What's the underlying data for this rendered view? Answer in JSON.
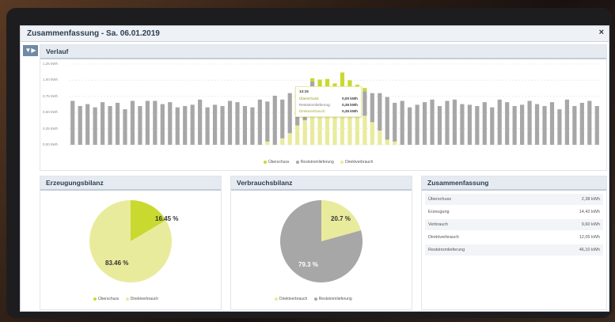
{
  "window": {
    "title": "Zusammenfassung - Sa. 06.01.2019",
    "close_label": "×",
    "filter_label": "▼▶"
  },
  "verlauf": {
    "title": "Verlauf"
  },
  "tooltip": {
    "time": "13:15",
    "rows": [
      {
        "label": "Überschuss:",
        "value": "0,00 kWh"
      },
      {
        "label": "Reststromlieferung:",
        "value": "0,35 kWh"
      },
      {
        "label": "Direktverbrauch:",
        "value": "0,35 kWh"
      }
    ]
  },
  "erzeugung": {
    "title": "Erzeugungsbilanz",
    "labels": [
      "16.45 %",
      "83.46 %"
    ],
    "legend": [
      "Überschuss",
      "Direktverbrauch"
    ]
  },
  "verbrauch": {
    "title": "Verbrauchsbilanz",
    "labels": [
      "20.7 %",
      "79.3 %"
    ],
    "legend": [
      "Direktverbrauch",
      "Reststromlieferung"
    ]
  },
  "summary": {
    "title": "Zusammenfassung",
    "rows": [
      {
        "label": "Überschuss",
        "value": "2,38 kWh"
      },
      {
        "label": "Erzeugung",
        "value": "14,42 kWh"
      },
      {
        "label": "Verbrauch",
        "value": "9,60 kWh"
      },
      {
        "label": "Direktverbrauch",
        "value": "12,05 kWh"
      },
      {
        "label": "Reststromlieferung",
        "value": "46,10 kWh"
      }
    ]
  },
  "colors": {
    "ueberschuss": "#c9d92f",
    "direkt": "#e9eb9c",
    "rest": "#a7a7a7"
  },
  "chart_data": [
    {
      "type": "bar",
      "ylabel": "",
      "ylim": [
        0,
        1.25
      ],
      "yticks": [
        "1,25 kWh",
        "1,00 kWh",
        "0,75 kWh",
        "0,50 kWh",
        "0,25 kWh",
        "0,00 kWh"
      ],
      "legend": [
        "Überschuss",
        "Reststromlieferung",
        "Direktverbrauch"
      ],
      "series": [
        {
          "name": "Reststromlieferung",
          "values": [
            0.68,
            0.6,
            0.63,
            0.58,
            0.66,
            0.6,
            0.65,
            0.55,
            0.68,
            0.6,
            0.68,
            0.68,
            0.63,
            0.66,
            0.58,
            0.6,
            0.62,
            0.7,
            0.58,
            0.62,
            0.6,
            0.68,
            0.66,
            0.6,
            0.58,
            0.7,
            0.62,
            0.76,
            0.6,
            0.62,
            0.6,
            0.5,
            0.4,
            0.28,
            0.17,
            0.1,
            0.1,
            0.22,
            0.28,
            0.38,
            0.45,
            0.58,
            0.66,
            0.6,
            0.68,
            0.58,
            0.62,
            0.66,
            0.7,
            0.6,
            0.68,
            0.7,
            0.63,
            0.62,
            0.6,
            0.66,
            0.58,
            0.7,
            0.66,
            0.6,
            0.62,
            0.68,
            0.63,
            0.6,
            0.66,
            0.55,
            0.7,
            0.6,
            0.65,
            0.68,
            0.6
          ]
        },
        {
          "name": "Überschuss",
          "values": [
            0,
            0,
            0,
            0,
            0,
            0,
            0,
            0,
            0,
            0,
            0,
            0,
            0,
            0,
            0,
            0,
            0,
            0,
            0,
            0,
            0,
            0,
            0,
            0,
            0,
            0,
            0,
            0,
            0,
            0,
            0,
            0,
            0.05,
            0.18,
            0.3,
            0.25,
            0.4,
            0.2,
            0.1,
            0.05,
            0,
            0,
            0,
            0,
            0,
            0,
            0,
            0,
            0,
            0,
            0,
            0,
            0,
            0,
            0,
            0,
            0,
            0,
            0,
            0,
            0,
            0,
            0,
            0,
            0,
            0,
            0,
            0,
            0,
            0,
            0
          ]
        },
        {
          "name": "Direktverbrauch",
          "values": [
            0,
            0,
            0,
            0,
            0,
            0,
            0,
            0,
            0,
            0,
            0,
            0,
            0,
            0,
            0,
            0,
            0,
            0,
            0,
            0,
            0,
            0,
            0,
            0,
            0,
            0,
            0.05,
            0,
            0.1,
            0.18,
            0.3,
            0.38,
            0.58,
            0.55,
            0.55,
            0.6,
            0.62,
            0.58,
            0.55,
            0.45,
            0.35,
            0.22,
            0.08,
            0.05,
            0,
            0,
            0,
            0,
            0,
            0,
            0,
            0,
            0,
            0,
            0,
            0,
            0,
            0,
            0,
            0,
            0,
            0,
            0,
            0,
            0,
            0,
            0,
            0,
            0,
            0,
            0
          ]
        }
      ]
    },
    {
      "type": "pie",
      "title": "Erzeugungsbilanz",
      "categories": [
        "Überschuss",
        "Direktverbrauch"
      ],
      "values": [
        16.45,
        83.46
      ]
    },
    {
      "type": "pie",
      "title": "Verbrauchsbilanz",
      "categories": [
        "Direktverbrauch",
        "Reststromlieferung"
      ],
      "values": [
        20.7,
        79.3
      ]
    }
  ]
}
